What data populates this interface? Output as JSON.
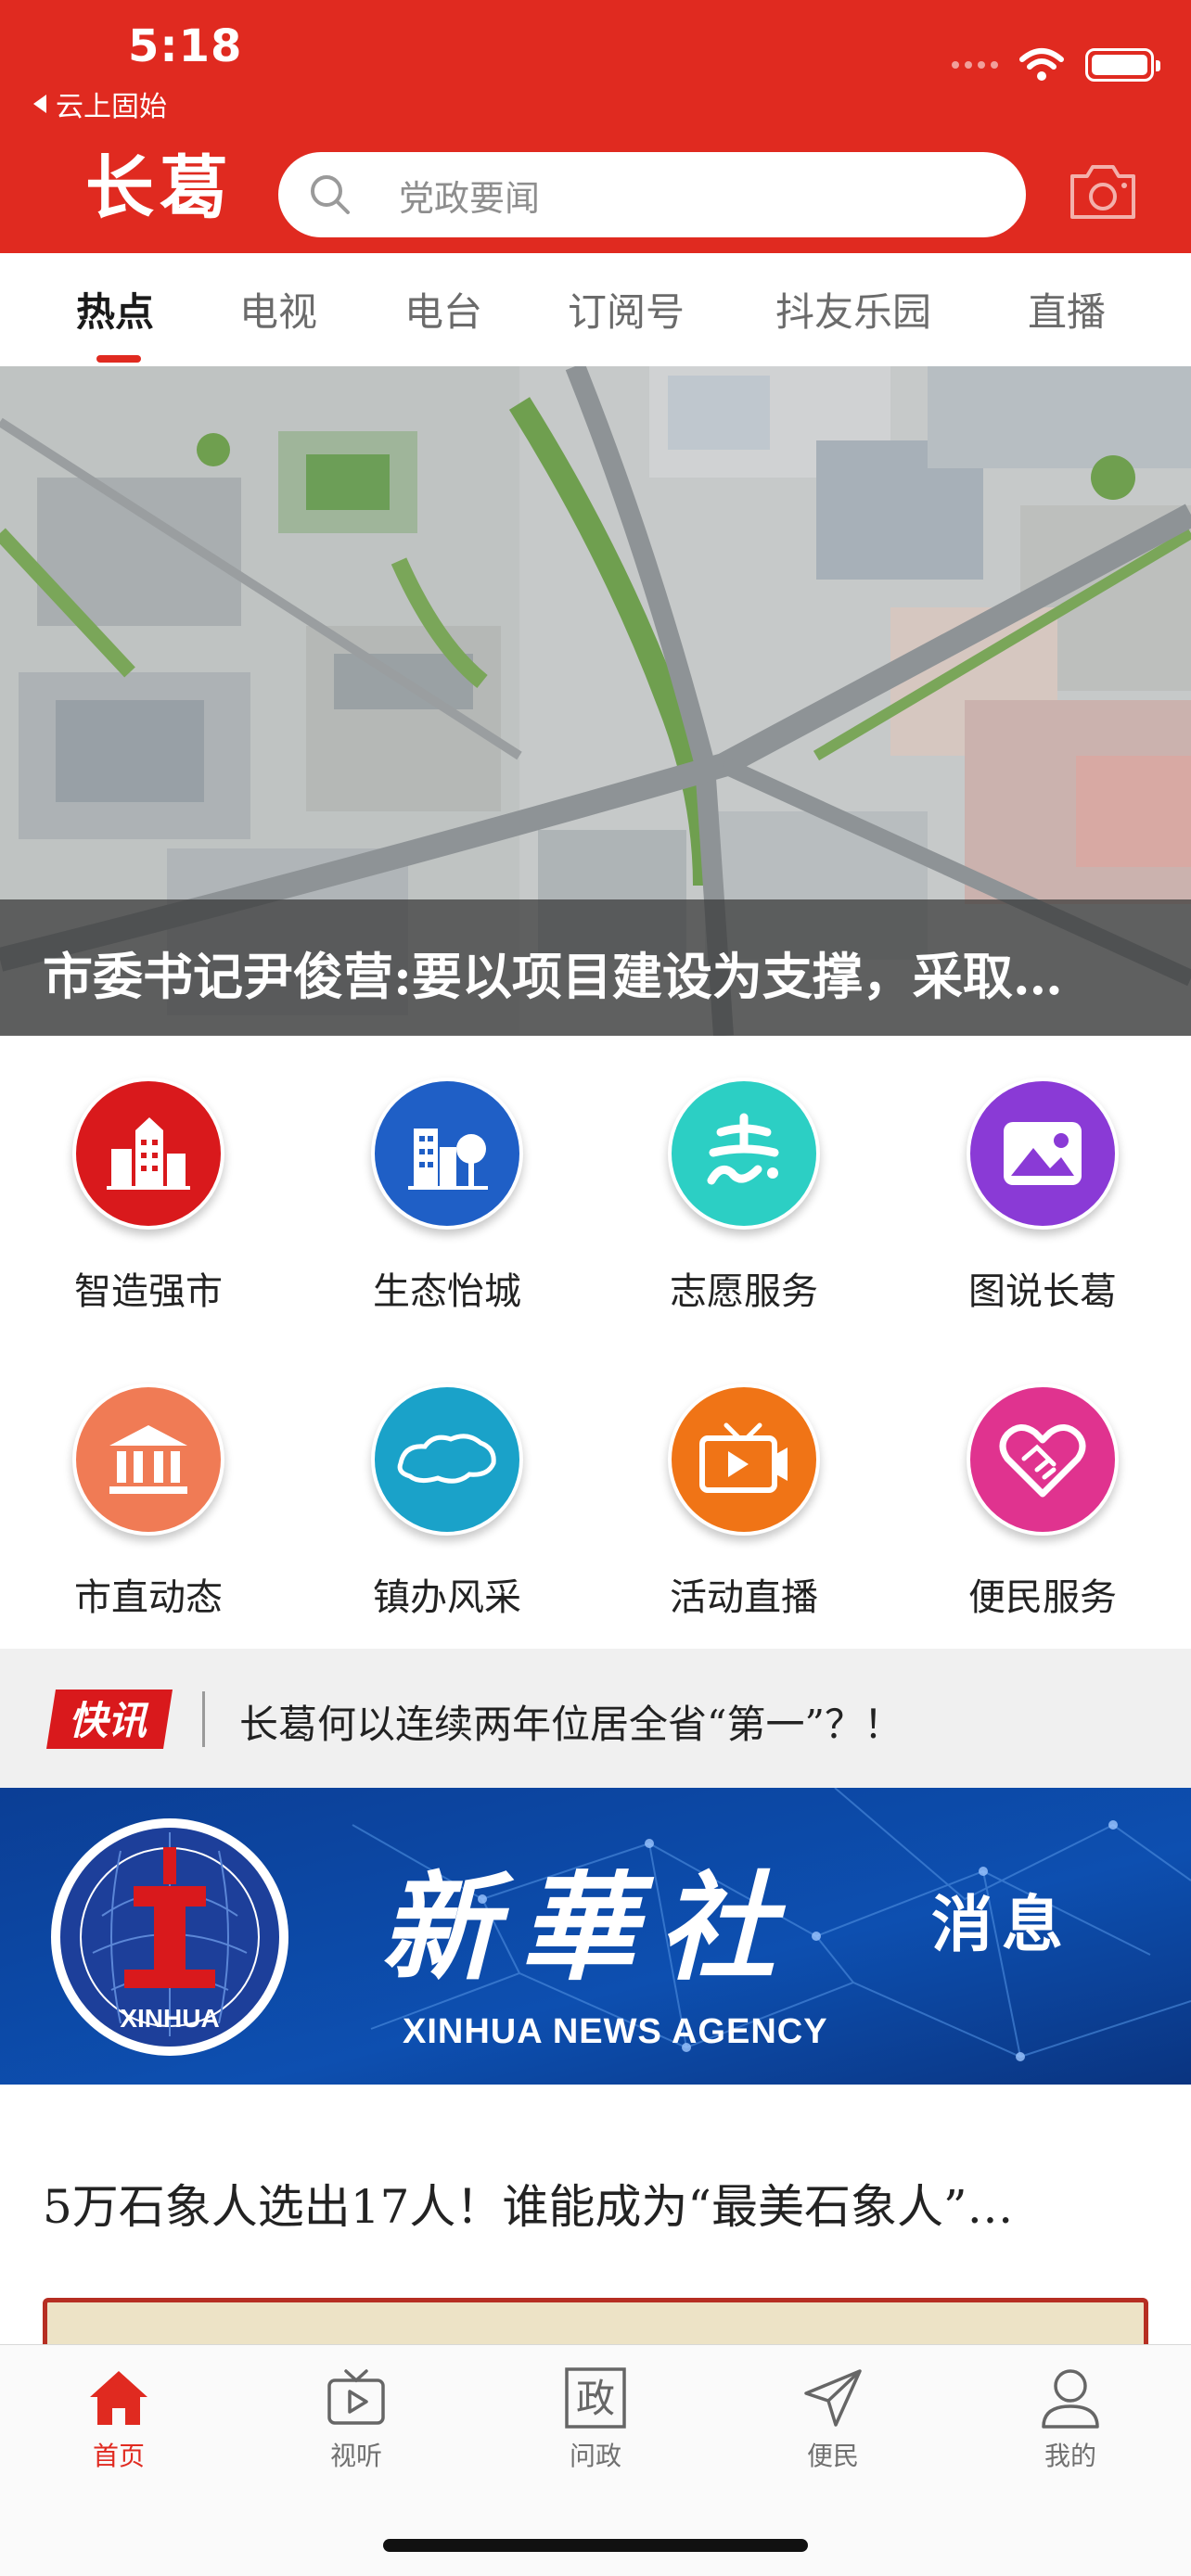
{
  "status_bar": {
    "time": "5:18",
    "back_app": "云上固始"
  },
  "header": {
    "logo_text": "长葛",
    "search_placeholder": "党政要闻",
    "theme_color": "#e02a20"
  },
  "tabs": [
    {
      "label": "热点",
      "active": true
    },
    {
      "label": "电视",
      "active": false
    },
    {
      "label": "电台",
      "active": false
    },
    {
      "label": "订阅号",
      "active": false
    },
    {
      "label": "抖友乐园",
      "active": false
    },
    {
      "label": "直播",
      "active": false
    }
  ],
  "hero": {
    "caption": "市委书记尹俊营:要以项目建设为支撑，采取…"
  },
  "services": [
    {
      "label": "智造强市",
      "icon": "factory-buildings-icon",
      "color": "#d9191c"
    },
    {
      "label": "生态怡城",
      "icon": "building-tree-icon",
      "color": "#1f5fc6"
    },
    {
      "label": "志愿服务",
      "icon": "volunteer-zhi-icon",
      "color": "#2ccfc4"
    },
    {
      "label": "图说长葛",
      "icon": "picture-icon",
      "color": "#8a3ad6"
    },
    {
      "label": "市直动态",
      "icon": "government-building-icon",
      "color": "#f07b55"
    },
    {
      "label": "镇办风采",
      "icon": "map-outline-icon",
      "color": "#1aa2c9"
    },
    {
      "label": "活动直播",
      "icon": "live-tv-icon",
      "color": "#f07416"
    },
    {
      "label": "便民服务",
      "icon": "heart-handshake-icon",
      "color": "#e0338f"
    }
  ],
  "news_flash": {
    "badge": "快讯",
    "text": "长葛何以连续两年位居全省“第一”？！"
  },
  "banner": {
    "name_cn": "新華社",
    "message": "消息",
    "name_en": "XINHUA NEWS AGENCY",
    "emblem_text": "XINHUA"
  },
  "article": {
    "title": "5万石象人选出17人！谁能成为“最美石象人”…"
  },
  "bottom_nav": [
    {
      "label": "首页",
      "icon": "home-icon",
      "active": true
    },
    {
      "label": "视听",
      "icon": "tv-play-icon",
      "active": false
    },
    {
      "label": "问政",
      "icon": "zheng-box-icon",
      "glyph": "政",
      "active": false
    },
    {
      "label": "便民",
      "icon": "paper-plane-icon",
      "active": false
    },
    {
      "label": "我的",
      "icon": "user-icon",
      "active": false
    }
  ]
}
